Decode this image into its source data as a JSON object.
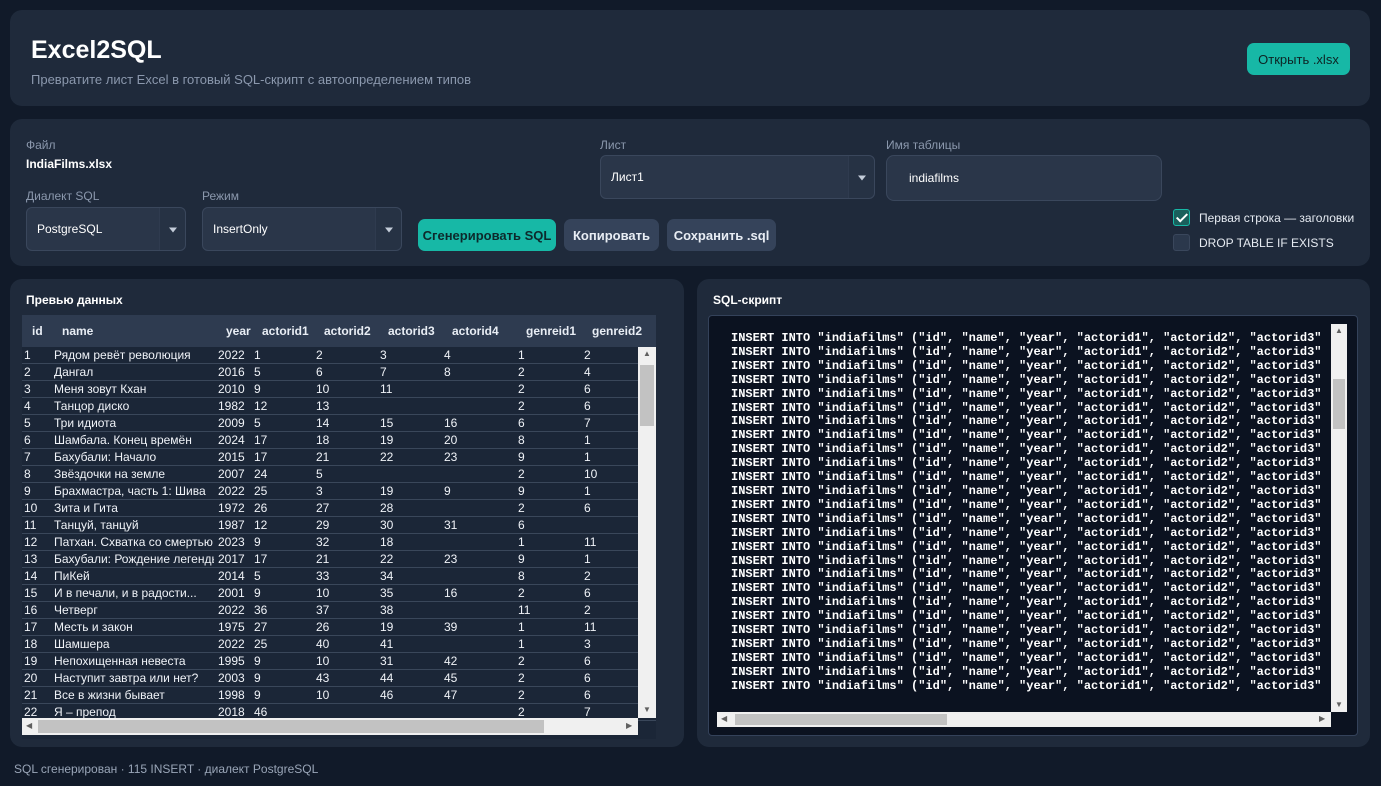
{
  "header": {
    "title": "Excel2SQL",
    "subtitle": "Превратите лист Excel в готовый SQL-скрипт с автоопределением типов",
    "open_button": "Открыть .xlsx"
  },
  "settings": {
    "file_label": "Файл",
    "file_name": "IndiaFilms.xlsx",
    "dialect_label": "Диалект SQL",
    "dialect_value": "PostgreSQL",
    "mode_label": "Режим",
    "mode_value": "InsertOnly",
    "sheet_label": "Лист",
    "sheet_value": "Лист1",
    "table_label": "Имя таблицы",
    "table_value": "indiafilms",
    "generate_button": "Сгенерировать SQL",
    "copy_button": "Копировать",
    "save_button": "Сохранить .sql",
    "header_row_checkbox": {
      "label": "Первая строка — заголовки",
      "checked": true
    },
    "drop_table_checkbox": {
      "label": "DROP TABLE IF EXISTS",
      "checked": false
    }
  },
  "preview": {
    "title": "Превью данных",
    "columns": [
      "id",
      "name",
      "year",
      "actorid1",
      "actorid2",
      "actorid3",
      "actorid4",
      "genreid1",
      "genreid2"
    ],
    "rows": [
      [
        "1",
        "Рядом ревёт революция",
        "2022",
        "1",
        "2",
        "3",
        "4",
        "1",
        "2"
      ],
      [
        "2",
        "Дангал",
        "2016",
        "5",
        "6",
        "7",
        "8",
        "2",
        "4"
      ],
      [
        "3",
        "Меня зовут Кхан",
        "2010",
        "9",
        "10",
        "11",
        "",
        "2",
        "6"
      ],
      [
        "4",
        "Танцор диско",
        "1982",
        "12",
        "13",
        "",
        "",
        "2",
        "6"
      ],
      [
        "5",
        "Три идиота",
        "2009",
        "5",
        "14",
        "15",
        "16",
        "6",
        "7"
      ],
      [
        "6",
        "Шамбала. Конец времён",
        "2024",
        "17",
        "18",
        "19",
        "20",
        "8",
        "1"
      ],
      [
        "7",
        "Бахубали: Начало",
        "2015",
        "17",
        "21",
        "22",
        "23",
        "9",
        "1"
      ],
      [
        "8",
        "Звёздочки на земле",
        "2007",
        "24",
        "5",
        "",
        "",
        "2",
        "10"
      ],
      [
        "9",
        "Брахмастра, часть 1: Шива",
        "2022",
        "25",
        "3",
        "19",
        "9",
        "9",
        "1"
      ],
      [
        "10",
        "Зита и Гита",
        "1972",
        "26",
        "27",
        "28",
        "",
        "2",
        "6"
      ],
      [
        "11",
        "Танцуй, танцуй",
        "1987",
        "12",
        "29",
        "30",
        "31",
        "6",
        ""
      ],
      [
        "12",
        "Патхан. Схватка со смертью",
        "2023",
        "9",
        "32",
        "18",
        "",
        "1",
        "11"
      ],
      [
        "13",
        "Бахубали: Рождение легенды",
        "2017",
        "17",
        "21",
        "22",
        "23",
        "9",
        "1"
      ],
      [
        "14",
        "ПиКей",
        "2014",
        "5",
        "33",
        "34",
        "",
        "8",
        "2"
      ],
      [
        "15",
        "И в печали, и в радости...",
        "2001",
        "9",
        "10",
        "35",
        "16",
        "2",
        "6"
      ],
      [
        "16",
        "Четверг",
        "2022",
        "36",
        "37",
        "38",
        "",
        "11",
        "2"
      ],
      [
        "17",
        "Месть и закон",
        "1975",
        "27",
        "26",
        "19",
        "39",
        "1",
        "11"
      ],
      [
        "18",
        "Шамшера",
        "2022",
        "25",
        "40",
        "41",
        "",
        "1",
        "3"
      ],
      [
        "19",
        "Непохищенная невеста",
        "1995",
        "9",
        "10",
        "31",
        "42",
        "2",
        "6"
      ],
      [
        "20",
        "Наступит завтра или нет?",
        "2003",
        "9",
        "43",
        "44",
        "45",
        "2",
        "6"
      ],
      [
        "21",
        "Все в жизни бывает",
        "1998",
        "9",
        "10",
        "46",
        "47",
        "2",
        "6"
      ],
      [
        "22",
        "Я – препод",
        "2018",
        "46",
        "",
        "",
        "",
        "2",
        "7"
      ]
    ]
  },
  "sql": {
    "title": "SQL-скрипт",
    "line_text": "INSERT INTO \"indiafilms\" (\"id\", \"name\", \"year\", \"actorid1\", \"actorid2\", \"actorid3\",",
    "last_line_text": "INSERT INTO \"indiafilms\" (\"id\", \"name\", \"year\", \"actorid1\", \"actorid2\", \"actorid3\",",
    "visible_line_count": 26
  },
  "status": "SQL сгенерирован · 115 INSERT · диалект PostgreSQL",
  "colors": {
    "background": "#111a29",
    "card": "#1f2a3b",
    "accent": "#17b8a6"
  }
}
